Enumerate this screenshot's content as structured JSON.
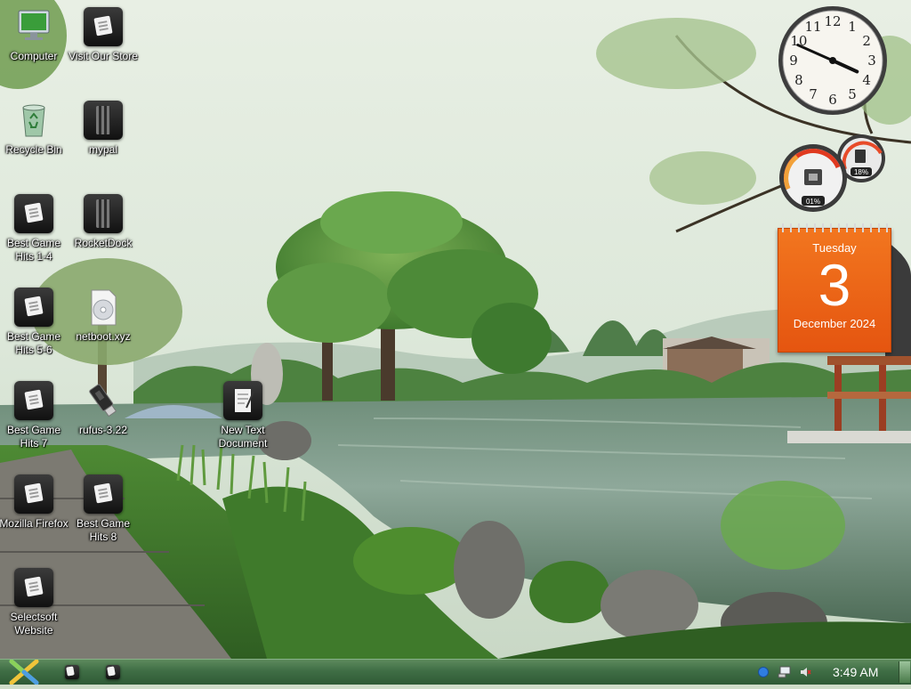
{
  "desktop": {
    "icons": [
      {
        "label": "Computer"
      },
      {
        "label": "Visit Our Store"
      },
      {
        "label": "Recycle Bin"
      },
      {
        "label": "mypal"
      },
      {
        "label": "Best Game Hits 1-4"
      },
      {
        "label": "RocketDock"
      },
      {
        "label": "Best Game Hits 5-6"
      },
      {
        "label": "netboot.xyz"
      },
      {
        "label": "Best Game Hits 7"
      },
      {
        "label": "rufus-3.22"
      },
      {
        "label": "New Text Document"
      },
      {
        "label": "Mozilla Firefox"
      },
      {
        "label": "Best Game Hits 8"
      },
      {
        "label": "Selectsoft Website"
      }
    ]
  },
  "gadgets": {
    "clock": {
      "numerals": [
        "12",
        "1",
        "2",
        "3",
        "4",
        "5",
        "6",
        "7",
        "8",
        "9",
        "10",
        "11"
      ],
      "hour": 3,
      "minute": 49
    },
    "cpu_meter": {
      "cpu_label": "01%",
      "memory_label": "18%"
    },
    "calendar": {
      "day_name": "Tuesday",
      "date": "3",
      "month_year": "December 2024",
      "color": "#ee6a1c"
    }
  },
  "taskbar": {
    "start_icon": "x-logo-icon",
    "apps": [
      {
        "icon": "app-window-icon"
      },
      {
        "icon": "app-window-icon"
      }
    ],
    "tray": {
      "icons": [
        "network-icon",
        "computer-icon",
        "volume-muted-icon"
      ]
    },
    "clock": "3:49 AM"
  },
  "colors": {
    "taskbar": "#3f6e45",
    "accent": "#ee6a1c"
  }
}
